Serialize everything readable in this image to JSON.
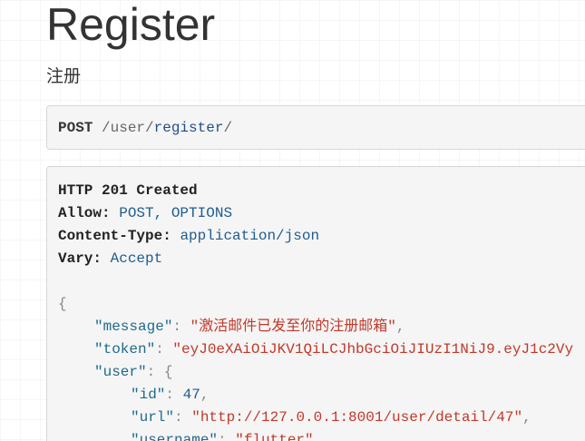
{
  "title": "Register",
  "description": "注册",
  "request": {
    "method": "POST",
    "path_parts": [
      "/user/",
      "register",
      "/"
    ]
  },
  "response": {
    "status_line": "HTTP 201 Created",
    "headers": [
      {
        "key": "Allow:",
        "value": "POST, OPTIONS"
      },
      {
        "key": "Content-Type:",
        "value": "application/json"
      },
      {
        "key": "Vary:",
        "value": "Accept"
      }
    ],
    "body": {
      "open_brace": "{",
      "message_key": "\"message\"",
      "message_value": "\"激活邮件已发至你的注册邮箱\"",
      "token_key": "\"token\"",
      "token_value": "\"eyJ0eXAiOiJKV1QiLCJhbGciOiJIUzI1NiJ9.eyJ1c2Vy",
      "user_key": "\"user\"",
      "user_open": "{",
      "id_key": "\"id\"",
      "id_value": "47",
      "url_key": "\"url\"",
      "url_value": "\"http://127.0.0.1:8001/user/detail/47\"",
      "username_key": "\"username\"",
      "username_value": "\"flutter\""
    }
  }
}
